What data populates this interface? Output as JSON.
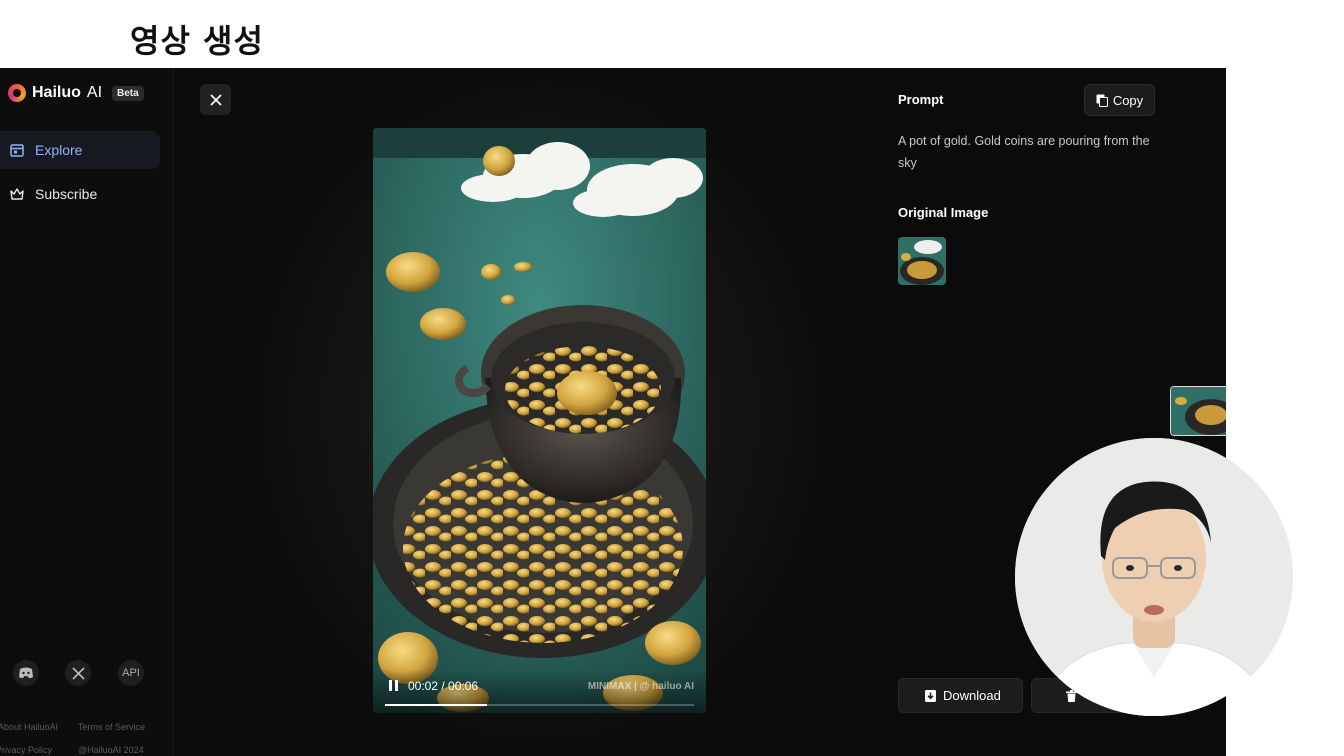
{
  "heading": "영상 생성",
  "sidebar": {
    "brand_name": "Hailuo",
    "brand_suffix": "AI",
    "badge": "Beta",
    "items": [
      {
        "label": "Explore",
        "icon": "calendar-icon",
        "active": true
      },
      {
        "label": "Subscribe",
        "icon": "crown-icon",
        "active": false
      }
    ],
    "social": {
      "api_label": "API"
    },
    "footer": [
      "About HailuoAI",
      "Terms of Service",
      "Privacy Policy",
      "@HailuoAI 2024"
    ]
  },
  "player": {
    "time": "00:02 / 00:06",
    "progress": 0.33,
    "watermark": "MINIMAX | @ hailuo AI"
  },
  "panel": {
    "prompt_title": "Prompt",
    "copy_label": "Copy",
    "prompt_text": "A pot of gold. Gold coins are pouring from the sky",
    "original_image_title": "Original Image",
    "download_label": "Download"
  },
  "colors": {
    "background": "#0b0b0b",
    "accent": "#8fb3ff",
    "gold": "#d8ad42"
  }
}
